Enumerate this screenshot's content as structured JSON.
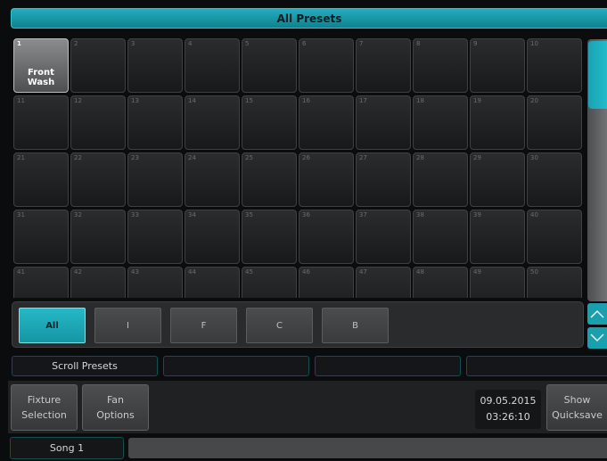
{
  "window": {
    "title": "All Presets"
  },
  "presets": [
    {
      "number": "1",
      "name": "Front Wash"
    },
    {
      "number": "2",
      "name": ""
    },
    {
      "number": "3",
      "name": ""
    },
    {
      "number": "4",
      "name": ""
    },
    {
      "number": "5",
      "name": ""
    },
    {
      "number": "6",
      "name": ""
    },
    {
      "number": "7",
      "name": ""
    },
    {
      "number": "8",
      "name": ""
    },
    {
      "number": "9",
      "name": ""
    },
    {
      "number": "10",
      "name": ""
    },
    {
      "number": "11",
      "name": ""
    },
    {
      "number": "12",
      "name": ""
    },
    {
      "number": "13",
      "name": ""
    },
    {
      "number": "14",
      "name": ""
    },
    {
      "number": "15",
      "name": ""
    },
    {
      "number": "16",
      "name": ""
    },
    {
      "number": "17",
      "name": ""
    },
    {
      "number": "18",
      "name": ""
    },
    {
      "number": "19",
      "name": ""
    },
    {
      "number": "20",
      "name": ""
    },
    {
      "number": "21",
      "name": ""
    },
    {
      "number": "22",
      "name": ""
    },
    {
      "number": "23",
      "name": ""
    },
    {
      "number": "24",
      "name": ""
    },
    {
      "number": "25",
      "name": ""
    },
    {
      "number": "26",
      "name": ""
    },
    {
      "number": "27",
      "name": ""
    },
    {
      "number": "28",
      "name": ""
    },
    {
      "number": "29",
      "name": ""
    },
    {
      "number": "30",
      "name": ""
    },
    {
      "number": "31",
      "name": ""
    },
    {
      "number": "32",
      "name": ""
    },
    {
      "number": "33",
      "name": ""
    },
    {
      "number": "34",
      "name": ""
    },
    {
      "number": "35",
      "name": ""
    },
    {
      "number": "36",
      "name": ""
    },
    {
      "number": "37",
      "name": ""
    },
    {
      "number": "38",
      "name": ""
    },
    {
      "number": "39",
      "name": ""
    },
    {
      "number": "40",
      "name": ""
    },
    {
      "number": "41",
      "name": ""
    },
    {
      "number": "42",
      "name": ""
    },
    {
      "number": "43",
      "name": ""
    },
    {
      "number": "44",
      "name": ""
    },
    {
      "number": "45",
      "name": ""
    },
    {
      "number": "46",
      "name": ""
    },
    {
      "number": "47",
      "name": ""
    },
    {
      "number": "48",
      "name": ""
    },
    {
      "number": "49",
      "name": ""
    },
    {
      "number": "50",
      "name": ""
    }
  ],
  "filters": {
    "active": "All",
    "items": [
      {
        "label": "All"
      },
      {
        "label": "I"
      },
      {
        "label": "F"
      },
      {
        "label": "C"
      },
      {
        "label": "B"
      }
    ]
  },
  "scroll": {
    "up_icon": "chevron-up-icon",
    "down_icon": "chevron-down-icon"
  },
  "encoders": {
    "labels": [
      "Scroll Presets",
      "",
      "",
      ""
    ]
  },
  "softkeys": {
    "fixture_selection": "Fixture\nSelection",
    "fan_options": "Fan\nOptions",
    "show_quicksave": "Show\nQuicksave"
  },
  "clock": {
    "date": "09.05.2015",
    "time": "03:26:10"
  },
  "song": {
    "label": "Song 1"
  },
  "colors": {
    "accent": "#1aa2b1",
    "tile_empty": "#222325",
    "tile_assigned": "#6e7072",
    "background": "#0b0c0d"
  }
}
